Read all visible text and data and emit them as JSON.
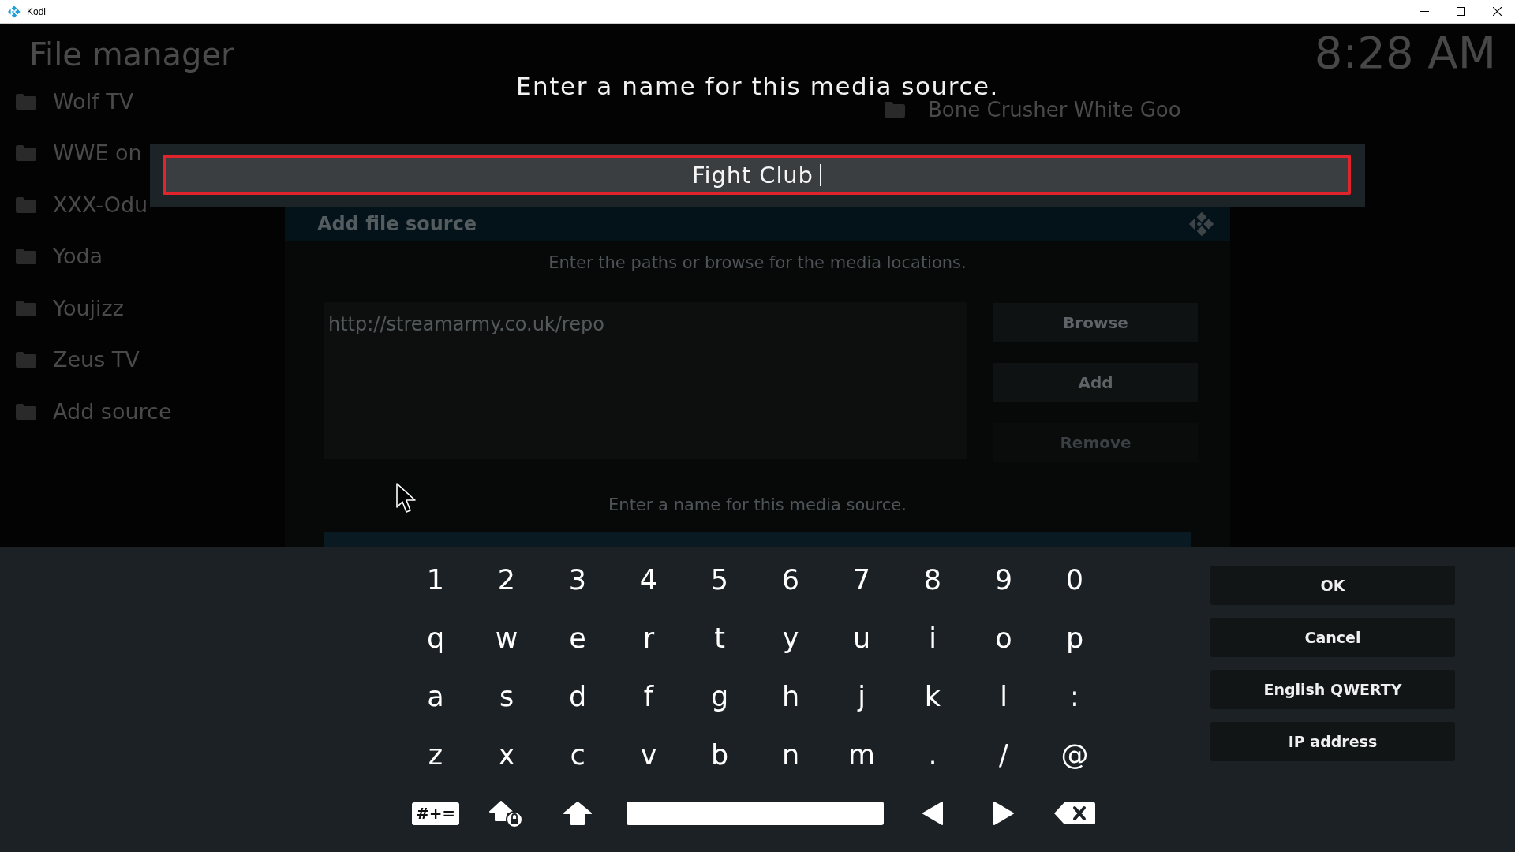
{
  "window": {
    "title": "Kodi"
  },
  "file_manager": {
    "title": "File manager",
    "clock": "8:28 AM",
    "left_sources": [
      {
        "label": "Wolf TV"
      },
      {
        "label": "WWE on"
      },
      {
        "label": "XXX-Odu"
      },
      {
        "label": "Yoda"
      },
      {
        "label": "Youjizz"
      },
      {
        "label": "Zeus TV"
      },
      {
        "label": "Add source"
      }
    ],
    "right_sources": [
      {
        "label": "Bone Crusher White Goo"
      }
    ]
  },
  "add_file_source": {
    "title": "Add file source",
    "paths_hint": "Enter the paths or browse for the media locations.",
    "paths": [
      "http://streamarmy.co.uk/repo"
    ],
    "buttons": [
      {
        "label": "Browse",
        "disabled": false
      },
      {
        "label": "Add",
        "disabled": false
      },
      {
        "label": "Remove",
        "disabled": true
      }
    ],
    "name_hint": "Enter a name for this media source."
  },
  "keyboard": {
    "heading": "Enter a name for this media source.",
    "value": "Fight Club",
    "rows": [
      [
        "1",
        "2",
        "3",
        "4",
        "5",
        "6",
        "7",
        "8",
        "9",
        "0"
      ],
      [
        "q",
        "w",
        "e",
        "r",
        "t",
        "y",
        "u",
        "i",
        "o",
        "p"
      ],
      [
        "a",
        "s",
        "d",
        "f",
        "g",
        "h",
        "j",
        "k",
        "l",
        ":"
      ],
      [
        "z",
        "x",
        "c",
        "v",
        "b",
        "n",
        "m",
        ".",
        "/",
        "@"
      ]
    ],
    "symbols_key": "#+=",
    "buttons": [
      "OK",
      "Cancel",
      "English QWERTY",
      "IP address"
    ]
  }
}
